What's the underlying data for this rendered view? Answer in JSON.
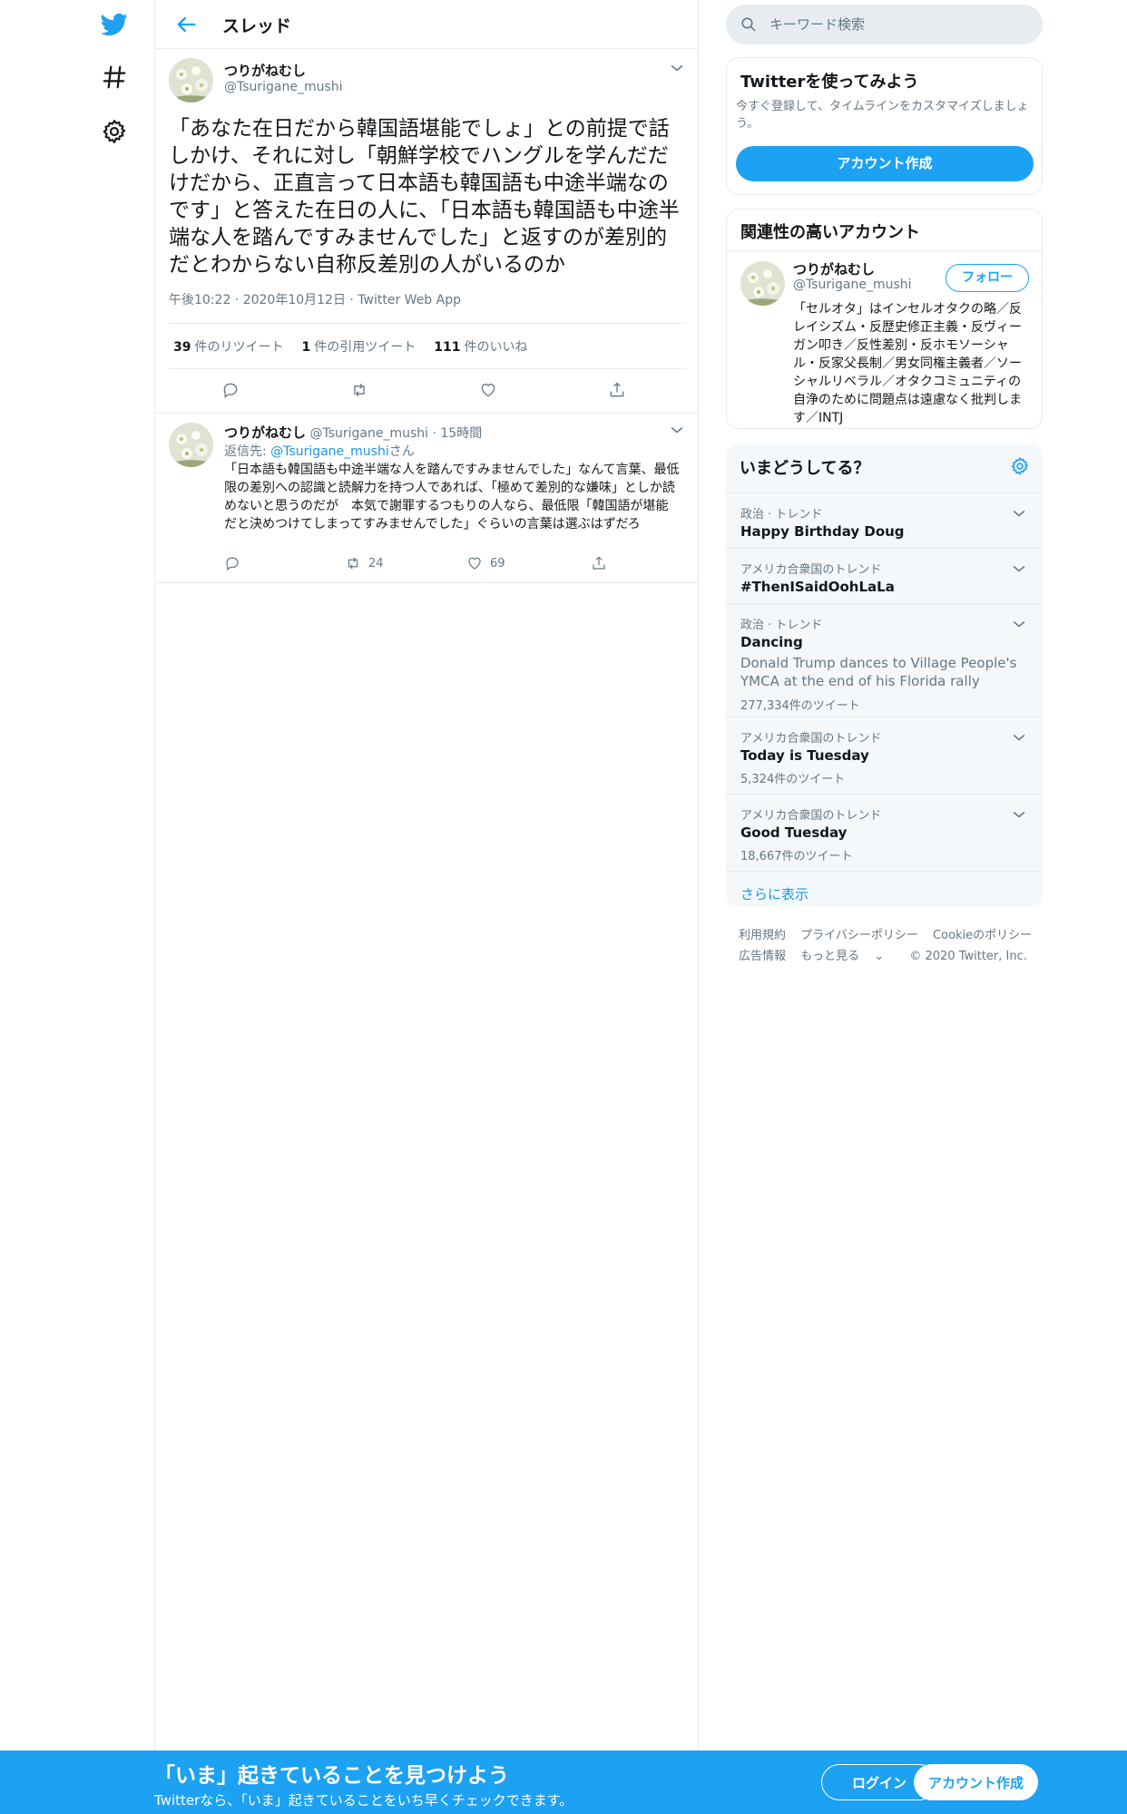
{
  "colors": {
    "accent": "#1da1f2",
    "link": "#1b95e0",
    "muted": "#657786",
    "border": "#e6ecf0"
  },
  "nav": {
    "icons": [
      "twitter-logo-icon",
      "hashtag-icon",
      "gear-icon"
    ]
  },
  "header": {
    "title": "スレッド"
  },
  "main_tweet": {
    "name": "つりがねむし",
    "handle": "@Tsurigane_mushi",
    "text": "「あなた在日だから韓国語堪能でしょ」との前提で話しかけ、それに対し「朝鮮学校でハングルを学んだだけだから、正直言って日本語も韓国語も中途半端なのです」と答えた在日の人に、「日本語も韓国語も中途半端な人を踏んですみませんでした」と返すのが差別的だとわからない自称反差別の人がいるのか",
    "meta": "午後10:22 · 2020年10月12日 · Twitter Web App",
    "retweets_count": "39",
    "retweets_label": "件のリツイート",
    "quotes_count": "1",
    "quotes_label": "件の引用ツイート",
    "likes_count": "111",
    "likes_label": "件のいいね"
  },
  "reply_tweet": {
    "name": "つりがねむし",
    "handle": "@Tsurigane_mushi",
    "time": "· 15時間",
    "reply_prefix": "返信先: ",
    "reply_to": "@Tsurigane_mushi",
    "reply_suffix": "さん",
    "text": "「日本語も韓国語も中途半端な人を踏んですみませんでした」なんて言葉、最低限の差別への認識と読解力を持つ人であれば、「極めて差別的な嫌味」としか読めないと思うのだが　本気で謝罪するつもりの人なら、最低限「韓国語が堪能だと決めつけてしまってすみませんでした」ぐらいの言葉は選ぶはずだろ",
    "retweets": "24",
    "likes": "69"
  },
  "search": {
    "placeholder": "キーワード検索"
  },
  "signup_card": {
    "title": "Twitterを使ってみよう",
    "desc": "今すぐ登録して、タイムラインをカスタマイズしましょう。",
    "button": "アカウント作成"
  },
  "related": {
    "title": "関連性の高いアカウント",
    "name": "つりがねむし",
    "handle": "@Tsurigane_mushi",
    "follow": "フォロー",
    "bio": "「セルオタ」はインセルオタクの略／反レイシズム・反歴史修正主義・反ヴィーガン叩き／反性差別・反ホモソーシャル・反家父長制／男女同権主義者／ソーシャルリベラル／オタクコミュニティの自浄のために問題点は遠慮なく批判します／INTJ"
  },
  "trends": {
    "title": "いまどうしてる？",
    "items": [
      {
        "context": "政治 · トレンド",
        "name": "Happy Birthday Doug"
      },
      {
        "context": "アメリカ合衆国のトレンド",
        "name": "#ThenISaidOohLaLa"
      },
      {
        "context": "政治 · トレンド",
        "name": "Dancing",
        "desc": "Donald Trump dances to Village People's YMCA at the end of his Florida rally",
        "count": "277,334件のツイート"
      },
      {
        "context": "アメリカ合衆国のトレンド",
        "name": "Today is Tuesday",
        "count": "5,324件のツイート"
      },
      {
        "context": "アメリカ合衆国のトレンド",
        "name": "Good Tuesday",
        "count": "18,667件のツイート"
      }
    ],
    "more": "さらに表示"
  },
  "footer": {
    "terms": "利用規約",
    "privacy": "プライバシーポリシー",
    "cookie": "Cookieのポリシー",
    "ads": "広告情報",
    "more": "もっと見る",
    "copyright": "© 2020 Twitter, Inc."
  },
  "bottom_bar": {
    "title": "「いま」起きていることを見つけよう",
    "subtitle": "Twitterなら、「いま」起きていることをいち早くチェックできます。",
    "login": "ログイン",
    "signup": "アカウント作成"
  }
}
